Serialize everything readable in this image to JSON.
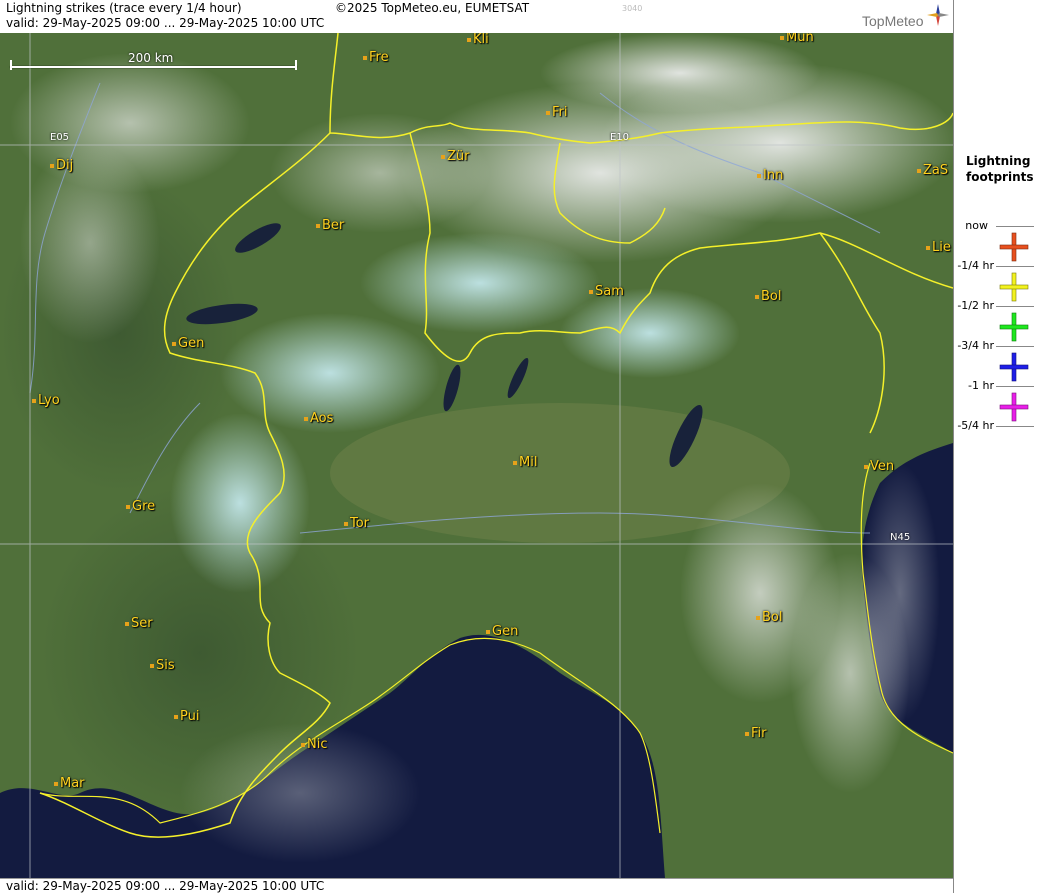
{
  "header": {
    "title": "Lightning strikes (trace every 1/4 hour)",
    "copyright": "©2025 TopMeteo.eu, EUMETSAT",
    "code": "3040",
    "valid": "valid:  29-May-2025 09:00 ... 29-May-2025 10:00 UTC",
    "logo": "TopMeteo"
  },
  "footer": {
    "valid": "valid:  29-May-2025 09:00 ... 29-May-2025 10:00 UTC"
  },
  "scale": {
    "label": "200 km"
  },
  "grid_labels": {
    "e05": "E05",
    "e10": "E10",
    "n45": "N45"
  },
  "cities": [
    {
      "id": "kli",
      "name": "Kli"
    },
    {
      "id": "mun",
      "name": "Mun"
    },
    {
      "id": "fre",
      "name": "Fre"
    },
    {
      "id": "fri",
      "name": "Fri"
    },
    {
      "id": "dij",
      "name": "Dij"
    },
    {
      "id": "zur",
      "name": "Zür"
    },
    {
      "id": "inn",
      "name": "Inn"
    },
    {
      "id": "zas",
      "name": "ZaS"
    },
    {
      "id": "ber",
      "name": "Ber"
    },
    {
      "id": "lie",
      "name": "Lie"
    },
    {
      "id": "sam",
      "name": "Sam"
    },
    {
      "id": "bol1",
      "name": "Bol"
    },
    {
      "id": "gen1",
      "name": "Gen"
    },
    {
      "id": "lyo",
      "name": "Lyo"
    },
    {
      "id": "aos",
      "name": "Aos"
    },
    {
      "id": "mil",
      "name": "Mil"
    },
    {
      "id": "ven",
      "name": "Ven"
    },
    {
      "id": "gre",
      "name": "Gre"
    },
    {
      "id": "tor",
      "name": "Tor"
    },
    {
      "id": "ser",
      "name": "Ser"
    },
    {
      "id": "gen2",
      "name": "Gen"
    },
    {
      "id": "bol2",
      "name": "Bol"
    },
    {
      "id": "sis",
      "name": "Sis"
    },
    {
      "id": "pui",
      "name": "Pui"
    },
    {
      "id": "nic",
      "name": "Nic"
    },
    {
      "id": "fir",
      "name": "Fir"
    },
    {
      "id": "mar",
      "name": "Mar"
    }
  ],
  "legend": {
    "title_line1": "Lightning",
    "title_line2": "footprints",
    "rows": [
      {
        "label": "now",
        "color": null
      },
      {
        "label": "-1/4 hr",
        "color": "#e8501e"
      },
      {
        "label": "-1/2 hr",
        "color": "#f2f21e"
      },
      {
        "label": "-3/4 hr",
        "color": "#1ee81e"
      },
      {
        "label": "-1 hr",
        "color": "#1e1ee8"
      },
      {
        "label": "-5/4 hr",
        "color": "#e81ee8"
      }
    ]
  },
  "colors": {
    "land": "#4f6e38",
    "sea": "#121a3e",
    "border": "#f5f02a",
    "city_label": "#ffd21f"
  }
}
